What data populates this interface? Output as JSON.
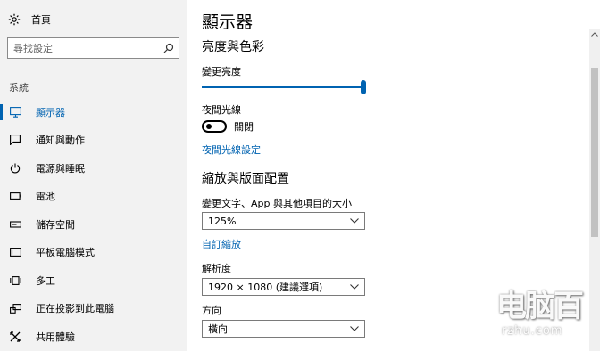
{
  "sidebar": {
    "home_label": "首頁",
    "search_placeholder": "尋找設定",
    "section_label": "系統",
    "items": [
      {
        "label": "顯示器",
        "icon": "monitor-icon",
        "active": true
      },
      {
        "label": "通知與動作",
        "icon": "notification-icon",
        "active": false
      },
      {
        "label": "電源與睡眠",
        "icon": "power-icon",
        "active": false
      },
      {
        "label": "電池",
        "icon": "battery-icon",
        "active": false
      },
      {
        "label": "儲存空間",
        "icon": "storage-icon",
        "active": false
      },
      {
        "label": "平板電腦模式",
        "icon": "tablet-icon",
        "active": false
      },
      {
        "label": "多工",
        "icon": "multitasking-icon",
        "active": false
      },
      {
        "label": "正在投影到此電腦",
        "icon": "projecting-icon",
        "active": false
      },
      {
        "label": "共用體驗",
        "icon": "shared-experience-icon",
        "active": false
      }
    ]
  },
  "main": {
    "title": "顯示器",
    "color_section": {
      "title": "亮度與色彩",
      "brightness_label": "變更亮度",
      "brightness_value": 1.0,
      "night_light_label": "夜間光線",
      "night_light_state": "關閉",
      "night_light_settings_link": "夜間光線設定"
    },
    "layout_section": {
      "title": "縮放與版面配置",
      "scale_label": "變更文字、App 與其他項目的大小",
      "scale_value": "125%",
      "custom_scale_link": "自訂縮放",
      "resolution_label": "解析度",
      "resolution_value": "1920 × 1080 (建議選項)",
      "orientation_label": "方向",
      "orientation_value": "橫向"
    }
  },
  "watermark": {
    "line1": "电脑百",
    "line2": "rzhu.com"
  },
  "colors": {
    "accent": "#0063b1",
    "sidebar_bg": "#f2f2f2"
  }
}
